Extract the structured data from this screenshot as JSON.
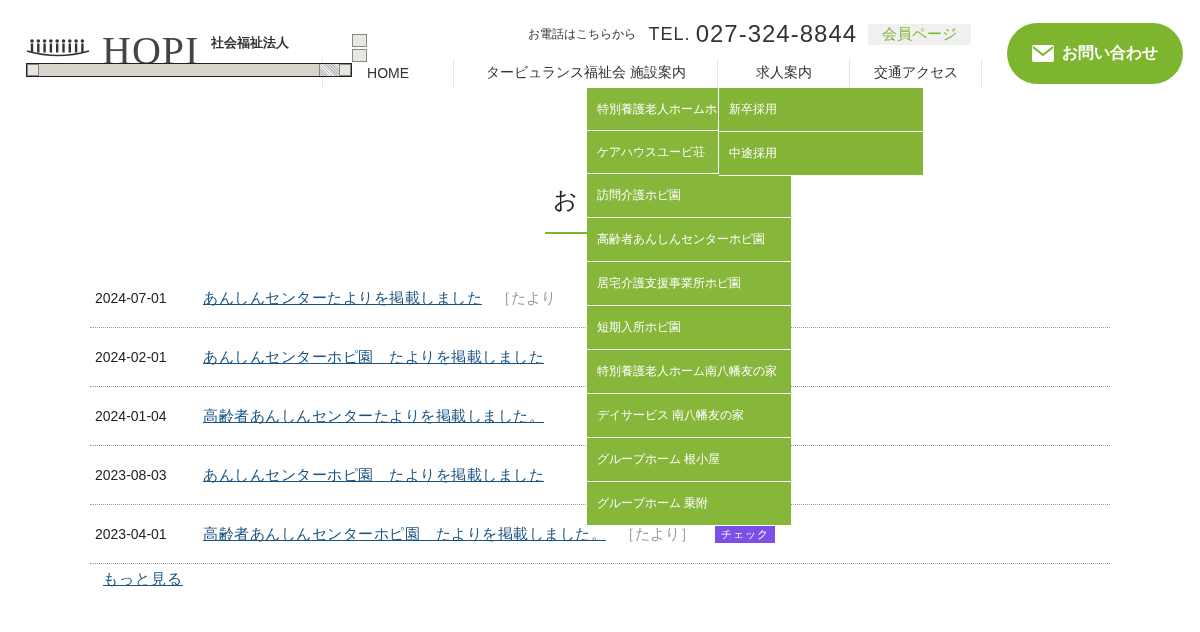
{
  "header": {
    "logo": {
      "name": "HOPI",
      "org_type": "社会福祉法人"
    },
    "phone_label": "お電話はこちらから",
    "tel_prefix": "TEL.",
    "tel": "027-324-8844",
    "member_link": "会員ページ",
    "contact_button": "お問い合わせ"
  },
  "nav": [
    {
      "label": "HOME"
    },
    {
      "label": "タービュランス福祉会 施設案内",
      "dropdown": [
        "特別養護老人ホームホ",
        "ケアハウスユービ荘",
        "訪問介護ホピ園",
        "高齢者あんしんセンターホピ園",
        "居宅介護支援事業所ホピ園",
        "短期入所ホピ園",
        "特別養護老人ホーム南八幡友の家",
        "デイサービス 南八幡友の家",
        "グループホーム 根小屋",
        "グループホーム 乗附"
      ]
    },
    {
      "label": "求人案内",
      "dropdown": [
        "新卒採用",
        "中途採用"
      ]
    },
    {
      "label": "交通アクセス"
    }
  ],
  "news_section": {
    "heading": "お",
    "items": [
      {
        "date": "2024-07-01",
        "title": "あんしんセンターたよりを掲載しました",
        "tag": "［たより"
      },
      {
        "date": "2024-02-01",
        "title": "あんしんセンターホピ園　たよりを掲載しました"
      },
      {
        "date": "2024-01-04",
        "title": "高齢者あんしんセンターたよりを掲載しました。"
      },
      {
        "date": "2023-08-03",
        "title": "あんしんセンターホピ園　たよりを掲載しました"
      },
      {
        "date": "2023-04-01",
        "title": "高齢者あんしんセンターホピ園　たよりを掲載しました。",
        "tag": "［たより］",
        "badge": "チェック"
      }
    ],
    "more_link": "もっと見る"
  }
}
